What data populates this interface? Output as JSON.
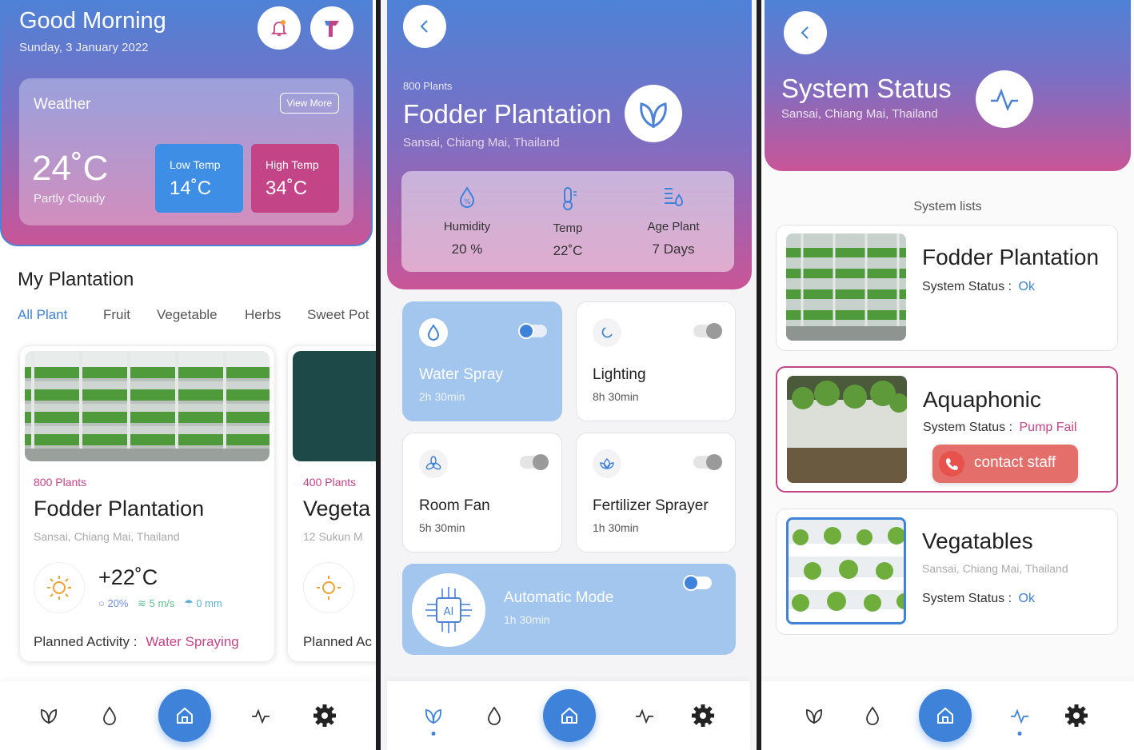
{
  "colors": {
    "accent": "#3f82d9",
    "pink": "#c44488",
    "red_button": "#e46e6a",
    "ok_blue": "#3f82d9"
  },
  "nav_icons": [
    "leaf-icon",
    "drop-icon",
    "home-icon",
    "pulse-icon",
    "gear-icon"
  ],
  "screen1": {
    "greeting": "Good Morning",
    "date": "Sunday, 3 January 2022",
    "weather": {
      "title": "Weather",
      "view_more": "View More",
      "temp": "24",
      "unit": "˚C",
      "condition": "Partly Cloudy",
      "low_label": "Low Temp",
      "low_value": "14˚C",
      "high_label": "High Temp",
      "high_value": "34˚C"
    },
    "section_title": "My Plantation",
    "tabs": [
      "All Plant",
      "Fruit",
      "Vegetable",
      "Herbs",
      "Sweet Pot"
    ],
    "cards": [
      {
        "count": "800 Plants",
        "name": "Fodder Plantation",
        "location": "Sansai, Chiang Mai, Thailand",
        "temp": "+22˚C",
        "humidity": "20%",
        "wind": "5 m/s",
        "rain": "0 mm",
        "activity_label": "Planned Activity :",
        "activity_value": "Water Spraying"
      },
      {
        "count": "400 Plants",
        "name": "Vegeta",
        "location": "12 Sukun M",
        "activity_label": "Planned Ac"
      }
    ]
  },
  "screen2": {
    "count": "800 Plants",
    "title": "Fodder Plantation",
    "location": "Sansai, Chiang Mai, Thailand",
    "stats": [
      {
        "label": "Humidity",
        "value": "20 %"
      },
      {
        "label": "Temp",
        "value": "22˚C"
      },
      {
        "label": "Age Plant",
        "value": "7 Days"
      }
    ],
    "controls": [
      {
        "name": "Water Spray",
        "time": "2h 30min",
        "on": true
      },
      {
        "name": "Lighting",
        "time": "8h 30min",
        "on": false
      },
      {
        "name": "Room Fan",
        "time": "5h 30min",
        "on": false
      },
      {
        "name": "Fertilizer Sprayer",
        "time": "1h 30min",
        "on": false
      }
    ],
    "auto_mode": {
      "name": "Automatic Mode",
      "time": "1h 30min",
      "chip_text": "AI"
    }
  },
  "screen3": {
    "title": "System Status",
    "location": "Sansai, Chiang Mai, Thailand",
    "list_title": "System lists",
    "items": [
      {
        "name": "Fodder Plantation",
        "status_label": "System Status :",
        "status": "Ok"
      },
      {
        "name": "Aquaphonic",
        "status_label": "System Status :",
        "status": "Pump Fail",
        "action": "contact staff"
      },
      {
        "name": "Vegatables",
        "location": "Sansai, Chiang Mai, Thailand",
        "status_label": "System Status :",
        "status": "Ok"
      }
    ]
  }
}
